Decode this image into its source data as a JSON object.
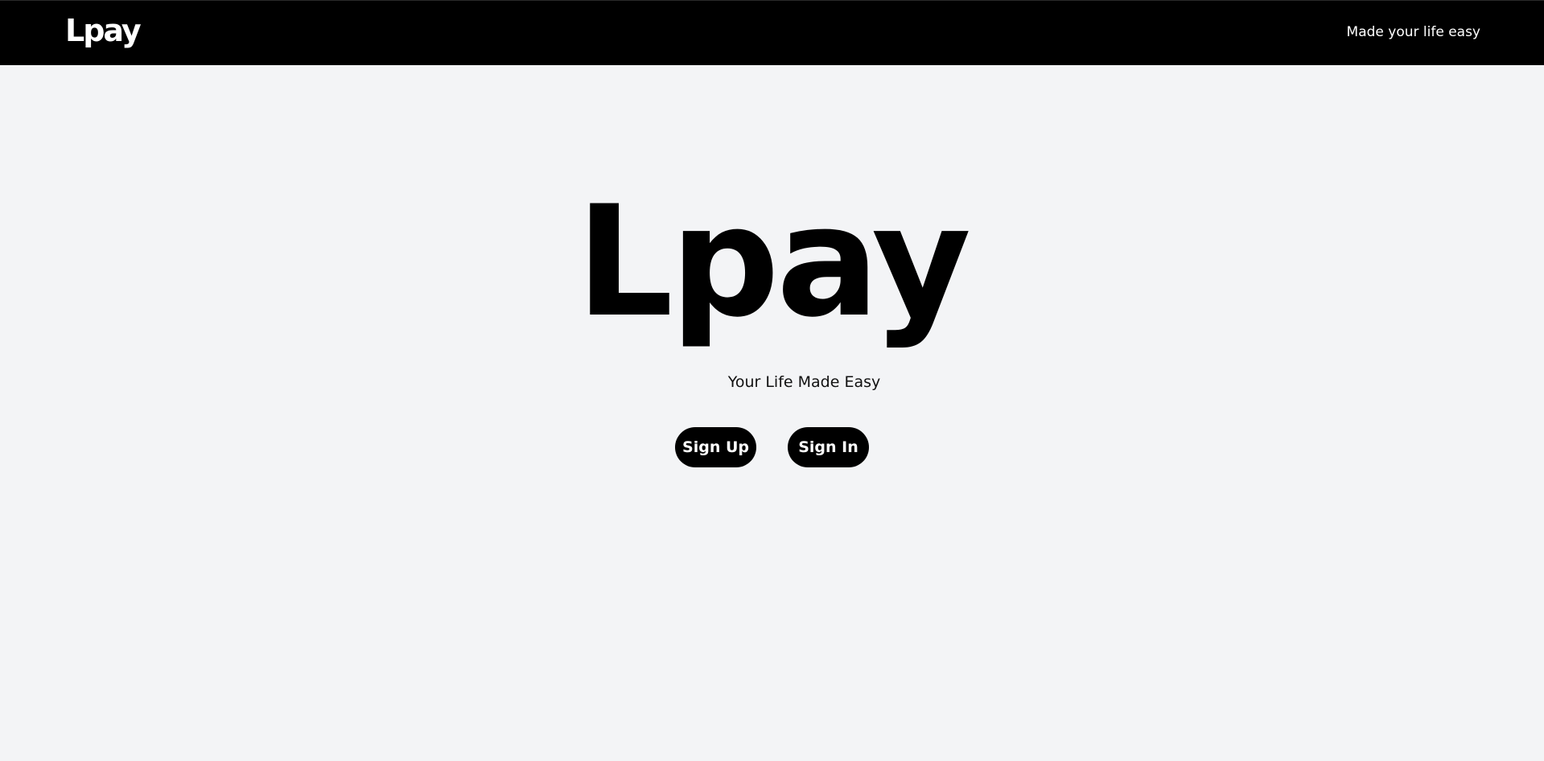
{
  "navbar": {
    "logo": "Lpay",
    "tagline": "Made your life easy"
  },
  "hero": {
    "title": "Lpay",
    "subtitle": "Your Life Made Easy",
    "buttons": {
      "sign_up": "Sign Up",
      "sign_in": "Sign In"
    }
  },
  "colors": {
    "navbar_bg": "#000000",
    "page_bg": "#f3f4f6",
    "button_bg": "#000000",
    "button_text": "#ffffff"
  }
}
